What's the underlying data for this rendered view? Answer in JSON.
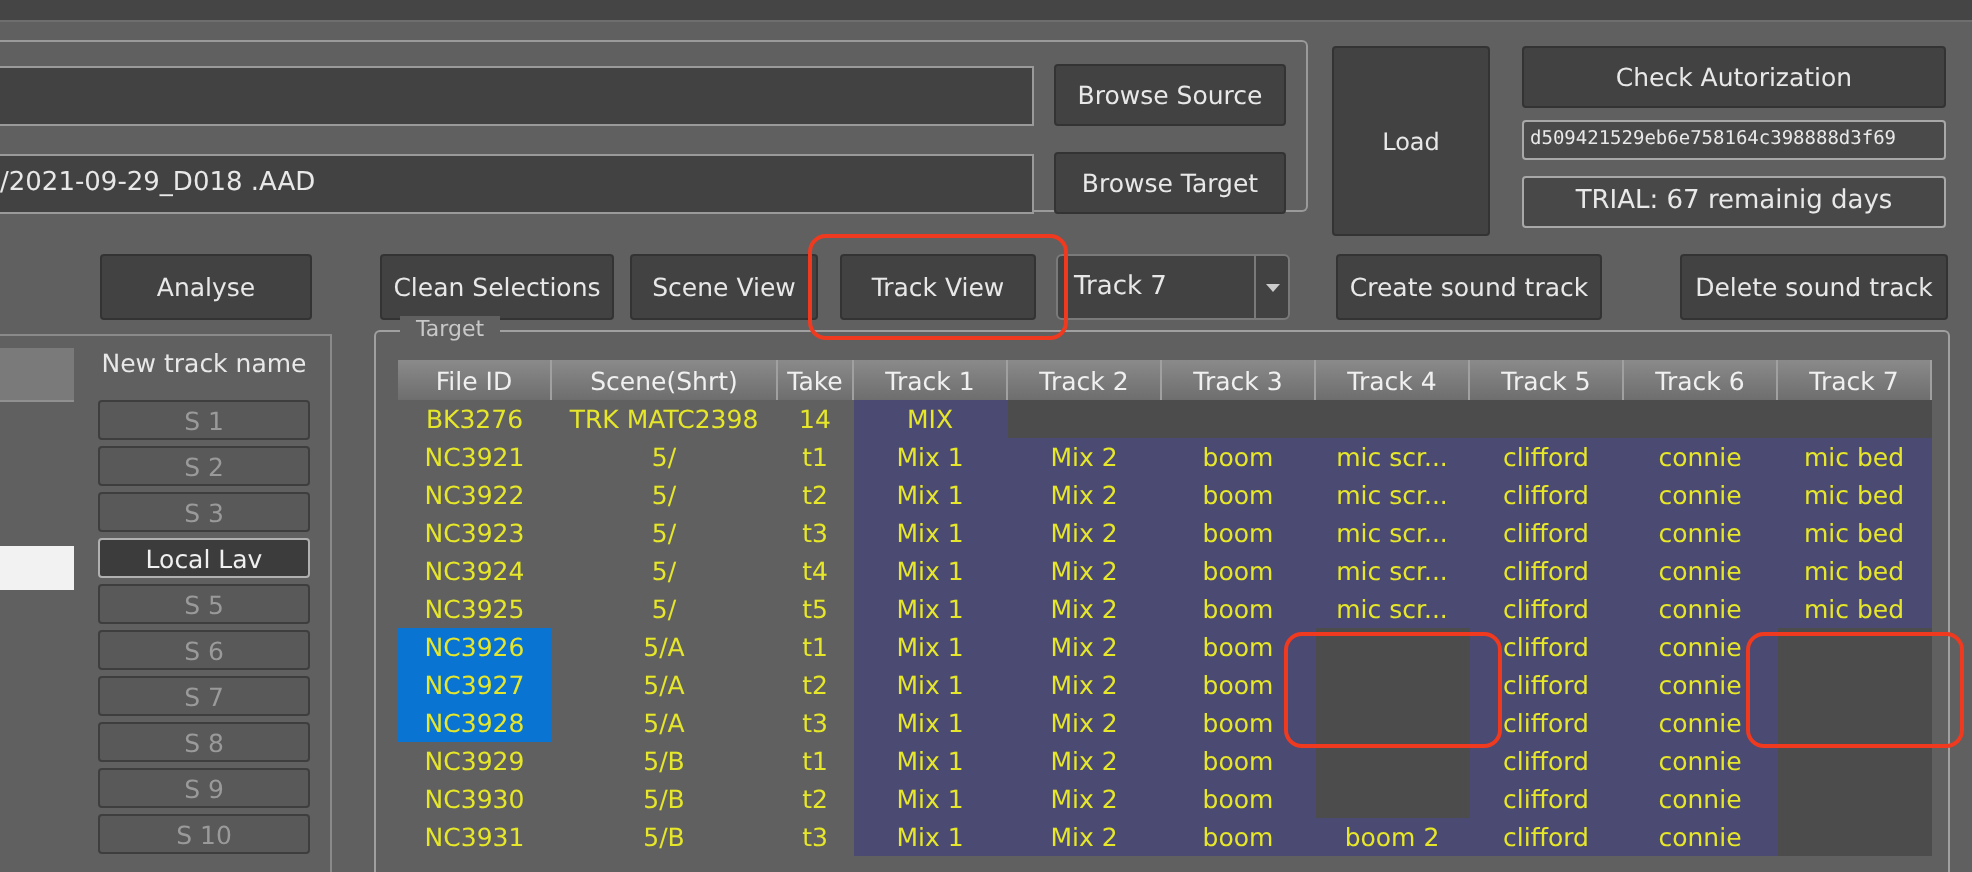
{
  "files": {
    "target": {
      "value": "/2021-09-29_D018 .AAD"
    },
    "buttons": [
      "Browse Source",
      "Browse Target"
    ]
  },
  "load_button": "Load",
  "authorization": {
    "button": "Check Autorization",
    "key": "d509421529eb6e758164c398888d3f69",
    "trial": "TRIAL: 67 remainig days"
  },
  "analyse_button": "Analyse",
  "toolbar": [
    {
      "kind": "button",
      "label": "Clean Selections"
    },
    {
      "kind": "button",
      "label": "Scene View"
    },
    {
      "kind": "button",
      "label": "Track View",
      "highlighted": true
    },
    {
      "kind": "dropdown",
      "label": "Track 7"
    },
    {
      "kind": "button",
      "label": "Create sound track"
    },
    {
      "kind": "button",
      "label": "Delete sound track"
    }
  ],
  "track_names": {
    "title": "New track name",
    "items": [
      {
        "label": "S 1",
        "selected": false
      },
      {
        "label": "S 2",
        "selected": false
      },
      {
        "label": "S 3",
        "selected": false
      },
      {
        "label": "Local Lav",
        "selected": true
      },
      {
        "label": "S 5",
        "selected": false
      },
      {
        "label": "S 6",
        "selected": false
      },
      {
        "label": "S 7",
        "selected": false
      },
      {
        "label": "S 8",
        "selected": false
      },
      {
        "label": "S 9",
        "selected": false
      },
      {
        "label": "S 10",
        "selected": false
      }
    ]
  },
  "target": {
    "title": "Target",
    "columns": [
      "File ID",
      "Scene(Shrt)",
      "Take",
      "Track 1",
      "Track 2",
      "Track 3",
      "Track 4",
      "Track 5",
      "Track 6",
      "Track 7"
    ],
    "rows": [
      {
        "file_id": "BK3276",
        "scene": "TRK MATC2398",
        "take": "14",
        "selected": false,
        "tracks": [
          {
            "kind": "text",
            "text": "MIX"
          },
          {
            "kind": "empty"
          },
          {
            "kind": "empty"
          },
          {
            "kind": "empty"
          },
          {
            "kind": "empty"
          },
          {
            "kind": "empty"
          },
          {
            "kind": "empty"
          }
        ]
      },
      {
        "file_id": "NC3921",
        "scene": "5/",
        "take": "t1",
        "selected": false,
        "tracks": [
          {
            "kind": "text",
            "text": "Mix 1"
          },
          {
            "kind": "text",
            "text": "Mix 2"
          },
          {
            "kind": "text",
            "text": "boom"
          },
          {
            "kind": "text",
            "text": "mic scr..."
          },
          {
            "kind": "text",
            "text": "clifford"
          },
          {
            "kind": "text",
            "text": "connie"
          },
          {
            "kind": "text",
            "text": "mic bed"
          }
        ]
      },
      {
        "file_id": "NC3922",
        "scene": "5/",
        "take": "t2",
        "selected": false,
        "tracks": [
          {
            "kind": "text",
            "text": "Mix 1"
          },
          {
            "kind": "text",
            "text": "Mix 2"
          },
          {
            "kind": "text",
            "text": "boom"
          },
          {
            "kind": "text",
            "text": "mic scr..."
          },
          {
            "kind": "text",
            "text": "clifford"
          },
          {
            "kind": "text",
            "text": "connie"
          },
          {
            "kind": "text",
            "text": "mic bed"
          }
        ]
      },
      {
        "file_id": "NC3923",
        "scene": "5/",
        "take": "t3",
        "selected": false,
        "tracks": [
          {
            "kind": "text",
            "text": "Mix 1"
          },
          {
            "kind": "text",
            "text": "Mix 2"
          },
          {
            "kind": "text",
            "text": "boom"
          },
          {
            "kind": "text",
            "text": "mic scr..."
          },
          {
            "kind": "text",
            "text": "clifford"
          },
          {
            "kind": "text",
            "text": "connie"
          },
          {
            "kind": "text",
            "text": "mic bed"
          }
        ]
      },
      {
        "file_id": "NC3924",
        "scene": "5/",
        "take": "t4",
        "selected": false,
        "tracks": [
          {
            "kind": "text",
            "text": "Mix 1"
          },
          {
            "kind": "text",
            "text": "Mix 2"
          },
          {
            "kind": "text",
            "text": "boom"
          },
          {
            "kind": "text",
            "text": "mic scr..."
          },
          {
            "kind": "text",
            "text": "clifford"
          },
          {
            "kind": "text",
            "text": "connie"
          },
          {
            "kind": "text",
            "text": "mic bed"
          }
        ]
      },
      {
        "file_id": "NC3925",
        "scene": "5/",
        "take": "t5",
        "selected": false,
        "tracks": [
          {
            "kind": "text",
            "text": "Mix 1"
          },
          {
            "kind": "text",
            "text": "Mix 2"
          },
          {
            "kind": "text",
            "text": "boom"
          },
          {
            "kind": "text",
            "text": "mic scr..."
          },
          {
            "kind": "text",
            "text": "clifford"
          },
          {
            "kind": "text",
            "text": "connie"
          },
          {
            "kind": "text",
            "text": "mic bed"
          }
        ]
      },
      {
        "file_id": "NC3926",
        "scene": "5/A",
        "take": "t1",
        "selected": true,
        "tracks": [
          {
            "kind": "text",
            "text": "Mix 1"
          },
          {
            "kind": "text",
            "text": "Mix 2"
          },
          {
            "kind": "text",
            "text": "boom"
          },
          {
            "kind": "empty",
            "highlighted": true
          },
          {
            "kind": "text",
            "text": "clifford"
          },
          {
            "kind": "text",
            "text": "connie"
          },
          {
            "kind": "empty",
            "highlighted": true
          }
        ]
      },
      {
        "file_id": "NC3927",
        "scene": "5/A",
        "take": "t2",
        "selected": true,
        "tracks": [
          {
            "kind": "text",
            "text": "Mix 1"
          },
          {
            "kind": "text",
            "text": "Mix 2"
          },
          {
            "kind": "text",
            "text": "boom"
          },
          {
            "kind": "empty",
            "highlighted": true
          },
          {
            "kind": "text",
            "text": "clifford"
          },
          {
            "kind": "text",
            "text": "connie"
          },
          {
            "kind": "empty",
            "highlighted": true
          }
        ]
      },
      {
        "file_id": "NC3928",
        "scene": "5/A",
        "take": "t3",
        "selected": true,
        "tracks": [
          {
            "kind": "text",
            "text": "Mix 1"
          },
          {
            "kind": "text",
            "text": "Mix 2"
          },
          {
            "kind": "text",
            "text": "boom"
          },
          {
            "kind": "empty",
            "highlighted": true
          },
          {
            "kind": "text",
            "text": "clifford"
          },
          {
            "kind": "text",
            "text": "connie"
          },
          {
            "kind": "empty",
            "highlighted": true
          }
        ]
      },
      {
        "file_id": "NC3929",
        "scene": "5/B",
        "take": "t1",
        "selected": false,
        "tracks": [
          {
            "kind": "text",
            "text": "Mix 1"
          },
          {
            "kind": "text",
            "text": "Mix 2"
          },
          {
            "kind": "text",
            "text": "boom"
          },
          {
            "kind": "empty"
          },
          {
            "kind": "text",
            "text": "clifford"
          },
          {
            "kind": "text",
            "text": "connie"
          },
          {
            "kind": "empty"
          }
        ]
      },
      {
        "file_id": "NC3930",
        "scene": "5/B",
        "take": "t2",
        "selected": false,
        "tracks": [
          {
            "kind": "text",
            "text": "Mix 1"
          },
          {
            "kind": "text",
            "text": "Mix 2"
          },
          {
            "kind": "text",
            "text": "boom"
          },
          {
            "kind": "empty"
          },
          {
            "kind": "text",
            "text": "clifford"
          },
          {
            "kind": "text",
            "text": "connie"
          },
          {
            "kind": "empty"
          }
        ]
      },
      {
        "file_id": "NC3931",
        "scene": "5/B",
        "take": "t3",
        "selected": false,
        "tracks": [
          {
            "kind": "text",
            "text": "Mix 1"
          },
          {
            "kind": "text",
            "text": "Mix 2"
          },
          {
            "kind": "text",
            "text": "boom"
          },
          {
            "kind": "text",
            "text": "boom 2"
          },
          {
            "kind": "text",
            "text": "clifford"
          },
          {
            "kind": "text",
            "text": "connie"
          },
          {
            "kind": "empty"
          }
        ]
      }
    ]
  }
}
